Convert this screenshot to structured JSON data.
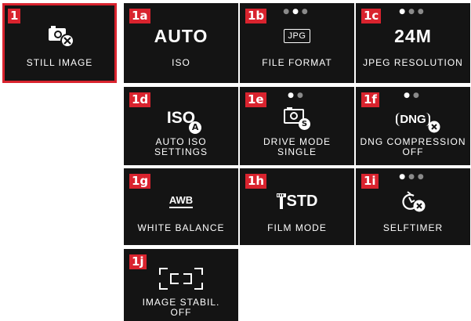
{
  "colors": {
    "tile_bg": "#141414",
    "accent": "#d9232e",
    "text": "#ffffff",
    "dot_dim": "#8a8a8a"
  },
  "tiles": [
    {
      "tag": "1",
      "label": "STILL IMAGE",
      "icon": "camera-settings-icon",
      "selected": true
    },
    {
      "tag": "1a",
      "value": "AUTO",
      "label": "ISO"
    },
    {
      "tag": "1b",
      "value": "JPG",
      "label": "FILE FORMAT",
      "icon": "jpg-format-icon"
    },
    {
      "tag": "1c",
      "value": "24M",
      "label": "JPEG RESOLUTION"
    },
    {
      "tag": "1d",
      "label_line1": "AUTO ISO",
      "label_line2": "SETTINGS",
      "icon": "auto-iso-icon",
      "icon_text": "ISO",
      "icon_badge": "A"
    },
    {
      "tag": "1e",
      "label_line1": "DRIVE MODE",
      "label_line2": "SINGLE",
      "icon": "drive-mode-icon",
      "icon_badge": "S"
    },
    {
      "tag": "1f",
      "label_line1": "DNG COMPRESSION",
      "label_line2": "OFF",
      "icon": "dng-compression-icon",
      "icon_text": "DNG"
    },
    {
      "tag": "1g",
      "value": "AWB",
      "label": "WHITE BALANCE",
      "icon": "white-balance-icon"
    },
    {
      "tag": "1h",
      "value": "STD",
      "label": "FILM MODE",
      "icon": "film-mode-icon"
    },
    {
      "tag": "1i",
      "label": "SELFTIMER",
      "icon": "selftimer-icon"
    },
    {
      "tag": "1j",
      "label_line1": "IMAGE STABIL.",
      "label_line2": "OFF",
      "icon": "image-stabilization-icon"
    }
  ]
}
